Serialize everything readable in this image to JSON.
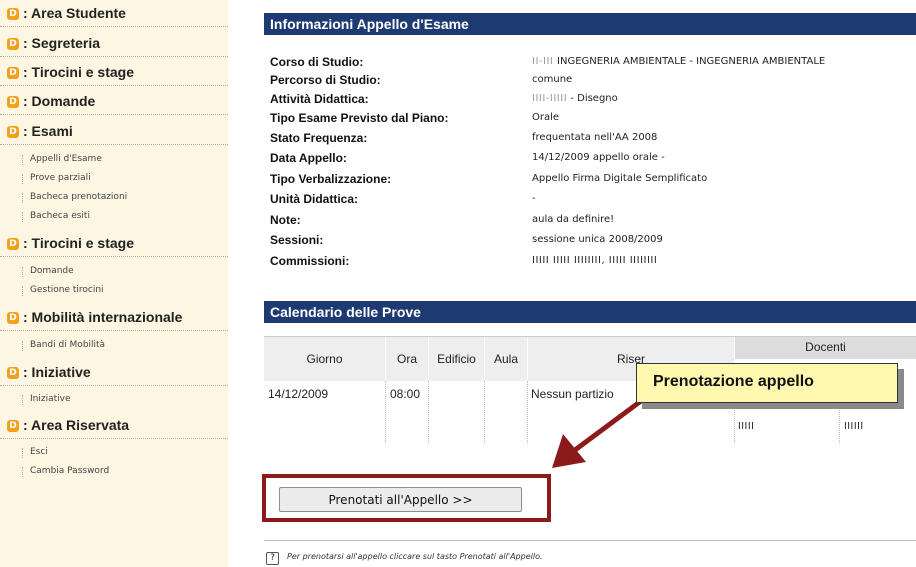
{
  "sidebar": {
    "sections": [
      {
        "label": ": Area Studente",
        "items": []
      },
      {
        "label": ": Segreteria",
        "items": []
      },
      {
        "label": ": Tirocini e stage",
        "items": []
      },
      {
        "label": ": Domande",
        "items": []
      },
      {
        "label": ": Esami",
        "items": [
          "Appelli d'Esame",
          "Prove parziali",
          "Bacheca prenotazioni",
          "Bacheca esiti"
        ]
      },
      {
        "label": ": Tirocini e stage",
        "items": [
          "Domande",
          "Gestione tirocini"
        ]
      },
      {
        "label": ": Mobilità internazionale",
        "items": [
          "Bandi di Mobilità"
        ]
      },
      {
        "label": ": Iniziative",
        "items": [
          "Iniziative"
        ]
      },
      {
        "label": ": Area Riservata",
        "items": [
          "Esci",
          "Cambia Password"
        ]
      }
    ]
  },
  "info": {
    "title": "Informazioni Appello d'Esame",
    "rows": [
      {
        "key": "Corso di Studio:",
        "value": "INGEGNERIA AMBIENTALE - INGEGNERIA AMBIENTALE",
        "blur_prefix": "II-III "
      },
      {
        "key": "Percorso di Studio:",
        "value": "comune"
      },
      {
        "key": "Attività Didattica:",
        "value": " - Disegno",
        "blur_prefix": "IIII-IIIII"
      },
      {
        "key": "Tipo Esame Previsto dal Piano:",
        "value": "Orale"
      },
      {
        "key": "Stato Frequenza:",
        "value": "frequentata nell'AA 2008"
      },
      {
        "key": "Data Appello:",
        "value": "14/12/2009 appello orale -"
      },
      {
        "key": "Tipo Verbalizzazione:",
        "value": "Appello Firma Digitale Semplificato"
      },
      {
        "key": "Unità Didattica:",
        "value": "-"
      },
      {
        "key": "Note:",
        "value": "aula da definire!"
      },
      {
        "key": "Sessioni:",
        "value": "sessione unica 2008/2009"
      },
      {
        "key": "Commissioni:",
        "value": "",
        "blur_prefix": "IIIII IIIII IIIIIIII, IIIII IIIIIIII"
      }
    ]
  },
  "calendar": {
    "title": "Calendario delle Prove",
    "headers": [
      "Giorno",
      "Ora",
      "Edificio",
      "Aula",
      "Riser",
      "Docenti"
    ],
    "row": {
      "giorno": "14/12/2009",
      "ora": "08:00",
      "riservato": "Nessun partizio"
    },
    "docenti_blur": [
      "IIIII",
      "IIIIII"
    ]
  },
  "callout": {
    "text": "Prenotazione appello"
  },
  "button": {
    "label": "Prenotati all'Appello >>"
  },
  "help": {
    "text": "Per prenotarsi all'appello cliccare sul tasto Prenotati all'Appello."
  },
  "colors": {
    "header_bg": "#1d3a73",
    "highlight": "#8b1a1a",
    "callout_bg": "#fff9b0",
    "sidebar_icon": "#f3a11d"
  }
}
